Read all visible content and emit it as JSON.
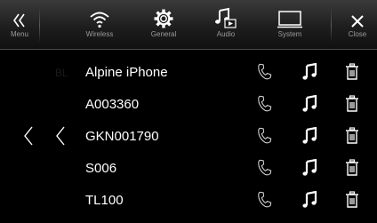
{
  "topbar": {
    "items": [
      {
        "label": "Menu",
        "icon": "double-chevron-left-icon"
      },
      {
        "label": "Wireless",
        "icon": "wifi-icon"
      },
      {
        "label": "General",
        "icon": "gear-icon"
      },
      {
        "label": "Audio",
        "icon": "audio-note-icon"
      },
      {
        "label": "System",
        "icon": "monitor-icon"
      },
      {
        "label": "Close",
        "icon": "close-icon"
      }
    ]
  },
  "devices": [
    {
      "name": "Alpine iPhone",
      "ghost": "BL"
    },
    {
      "name": "A003360"
    },
    {
      "name": "GKN001790"
    },
    {
      "name": "S006"
    },
    {
      "name": "TL100"
    }
  ],
  "colors": {
    "background": "#000000",
    "text": "#ffffff",
    "label": "#9a9a9a"
  }
}
